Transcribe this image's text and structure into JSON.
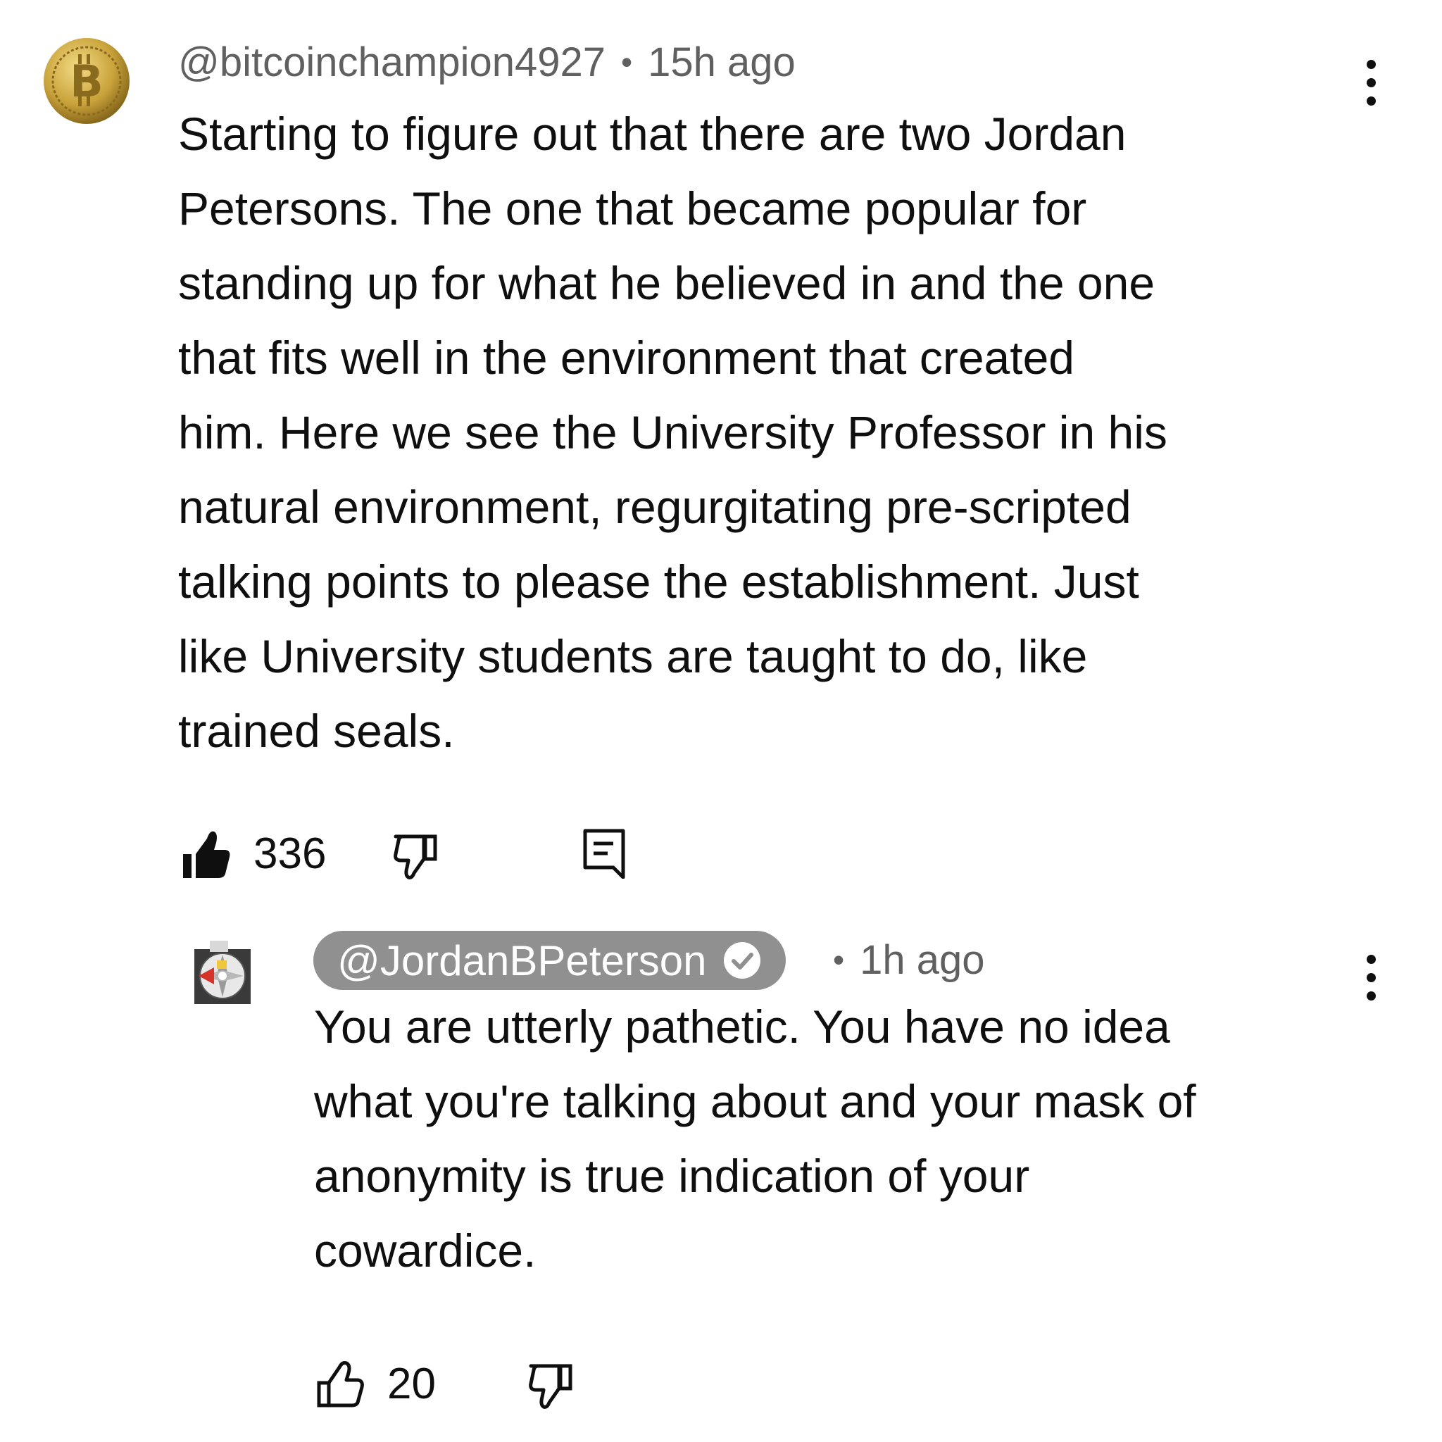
{
  "comment": {
    "author_handle": "@bitcoinchampion4927",
    "separator": "•",
    "timestamp": "15h ago",
    "text": "Starting to figure out that there are two Jordan\nPetersons. The one that became popular for\nstanding up for what he believed in and the one\nthat fits well in the environment that created\nhim. Here we see the University Professor in his\nnatural environment, regurgitating pre-scripted\ntalking points to please the establishment. Just\nlike University students are taught to do, like\ntrained seals.",
    "like_count": "336",
    "avatar_icon": "bitcoin-coin-icon",
    "like_icon": "thumbs-up-filled-icon",
    "dislike_icon": "thumbs-down-outline-icon",
    "reply_icon": "reply-comment-icon",
    "menu_icon": "more-vertical-icon"
  },
  "reply": {
    "author_handle": "@JordanBPeterson",
    "separator": "•",
    "timestamp": "1h ago",
    "text": "You are utterly pathetic. You have no idea\nwhat you're talking about and your mask of\nanonymity is true indication of your\ncowardice.",
    "like_count": "20",
    "verified_icon": "verified-check-icon",
    "avatar_icon": "creator-logo-icon",
    "like_icon": "thumbs-up-outline-icon",
    "dislike_icon": "thumbs-down-outline-icon",
    "menu_icon": "more-vertical-icon"
  },
  "colors": {
    "text_primary": "#0f0f0f",
    "text_secondary": "#606060",
    "creator_pill": "#909090",
    "coin_gold": "#c9a23a"
  }
}
